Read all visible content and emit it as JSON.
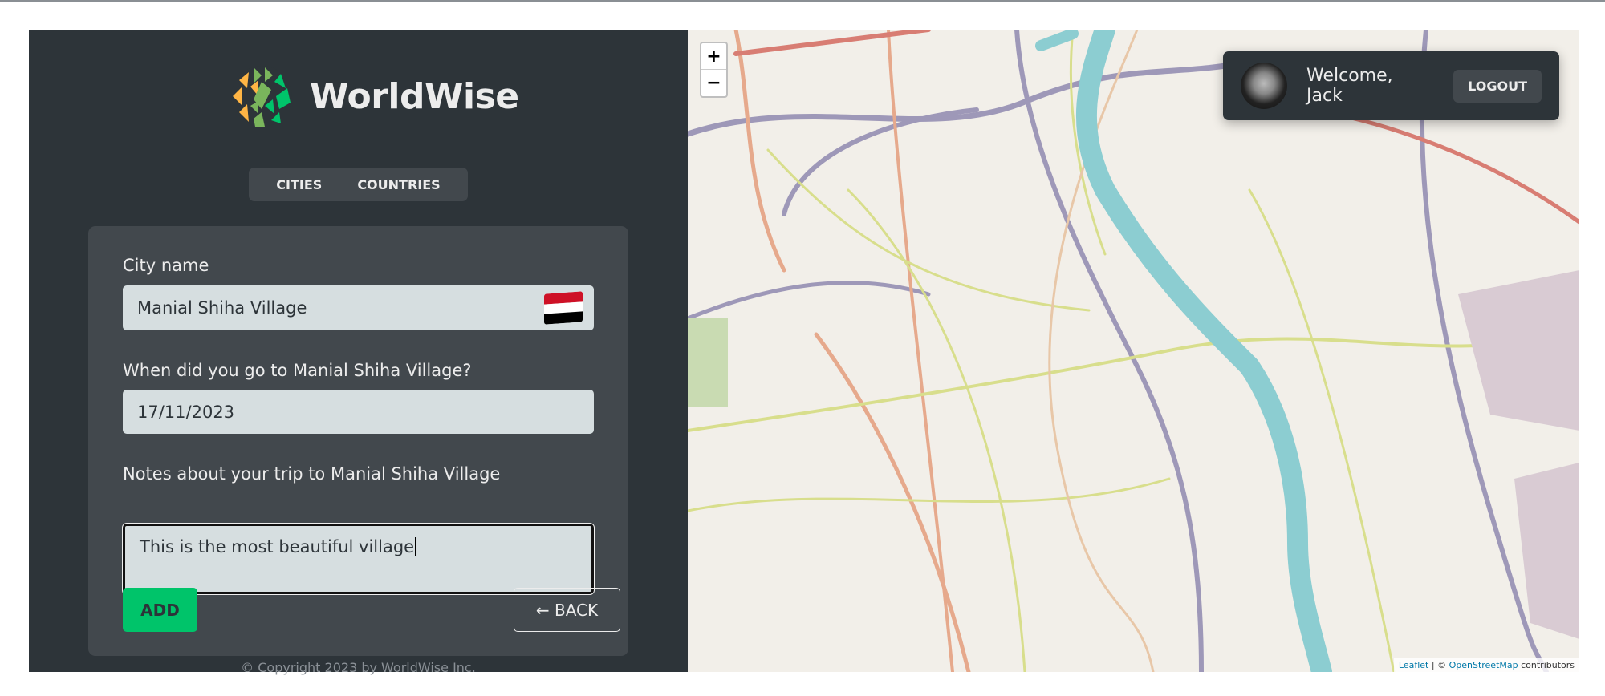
{
  "app": {
    "name": "WorldWise",
    "copyright": "© Copyright 2023 by WorldWise Inc."
  },
  "nav": {
    "tabs": [
      {
        "label": "CITIES"
      },
      {
        "label": "COUNTRIES"
      }
    ]
  },
  "form": {
    "city_label": "City name",
    "city_value": "Manial Shiha Village",
    "country_flag": "Egypt",
    "date_label": "When did you go to Manial Shiha Village?",
    "date_value": "17/11/2023",
    "notes_label": "Notes about your trip to Manial Shiha Village",
    "notes_value": "This is the most beautiful village",
    "add_label": "ADD",
    "back_label": "← BACK"
  },
  "map": {
    "zoom_in": "+",
    "zoom_out": "−",
    "attribution_leaflet": "Leaflet",
    "attribution_sep": " | © ",
    "attribution_osm": "OpenStreetMap",
    "attribution_tail": " contributors"
  },
  "user": {
    "welcome": "Welcome, Jack",
    "logout_label": "LOGOUT"
  },
  "colors": {
    "sidebar": "#2d3439",
    "card": "#42484d",
    "accent": "#00c46a",
    "input": "#d6dee0"
  }
}
